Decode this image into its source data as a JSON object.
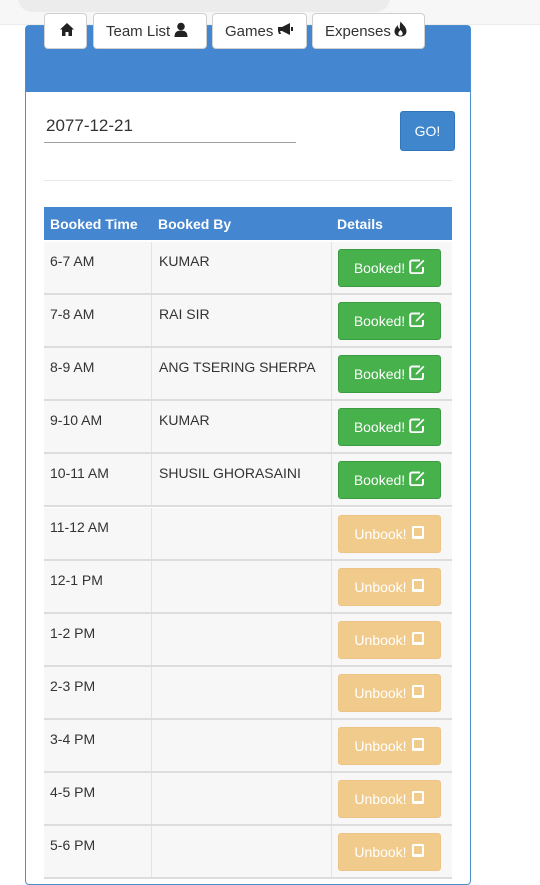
{
  "colors": {
    "primary": "#4486cf",
    "booked": "#47b14c",
    "unbook": "#f1cb8c"
  },
  "nav": {
    "home_icon": "home-icon",
    "items": [
      {
        "label": "Team List",
        "icon": "user-icon"
      },
      {
        "label": "Games",
        "icon": "bullhorn-icon"
      },
      {
        "label": "Expenses",
        "icon": "fire-icon"
      }
    ]
  },
  "search": {
    "date_value": "2077-12-21",
    "go_label": "GO!"
  },
  "table": {
    "headers": [
      "Booked Time",
      "Booked By",
      "Details"
    ],
    "rows": [
      {
        "time": "6-7 AM",
        "by": "KUMAR",
        "status": "Booked!"
      },
      {
        "time": "7-8 AM",
        "by": "RAI SIR",
        "status": "Booked!"
      },
      {
        "time": "8-9 AM",
        "by": "ANG TSERING SHERPA",
        "status": "Booked!"
      },
      {
        "time": "9-10 AM",
        "by": "KUMAR",
        "status": "Booked!"
      },
      {
        "time": "10-11 AM",
        "by": "SHUSIL GHORASAINI",
        "status": "Booked!"
      },
      {
        "time": "11-12 AM",
        "by": "",
        "status": "Unbook!"
      },
      {
        "time": "12-1 PM",
        "by": "",
        "status": "Unbook!"
      },
      {
        "time": "1-2 PM",
        "by": "",
        "status": "Unbook!"
      },
      {
        "time": "2-3 PM",
        "by": "",
        "status": "Unbook!"
      },
      {
        "time": "3-4 PM",
        "by": "",
        "status": "Unbook!"
      },
      {
        "time": "4-5 PM",
        "by": "",
        "status": "Unbook!"
      },
      {
        "time": "5-6 PM",
        "by": "",
        "status": "Unbook!"
      }
    ]
  }
}
